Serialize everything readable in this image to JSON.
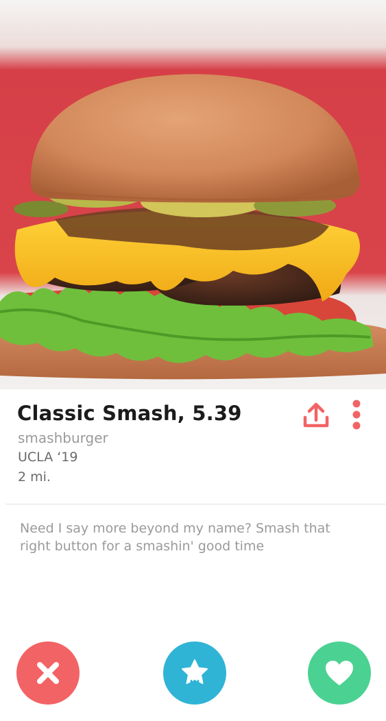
{
  "profile": {
    "name_age": "Classic Smash, 5.39",
    "subtitle": "smashburger",
    "school": "UCLA ‘19",
    "distance": "2 mi."
  },
  "bio": {
    "text": "Need I say more beyond my name? Smash that right button for a smashin' good time"
  },
  "icons": {
    "share": "share-upload-icon",
    "more": "more-vertical-dots-icon",
    "nope": "close-x-icon",
    "super_like": "star-icon",
    "like": "heart-icon"
  },
  "colors": {
    "accent": "#f26365",
    "nope_button": "#f26365",
    "super_like_button": "#2fb4d6",
    "like_button": "#4bd192"
  }
}
